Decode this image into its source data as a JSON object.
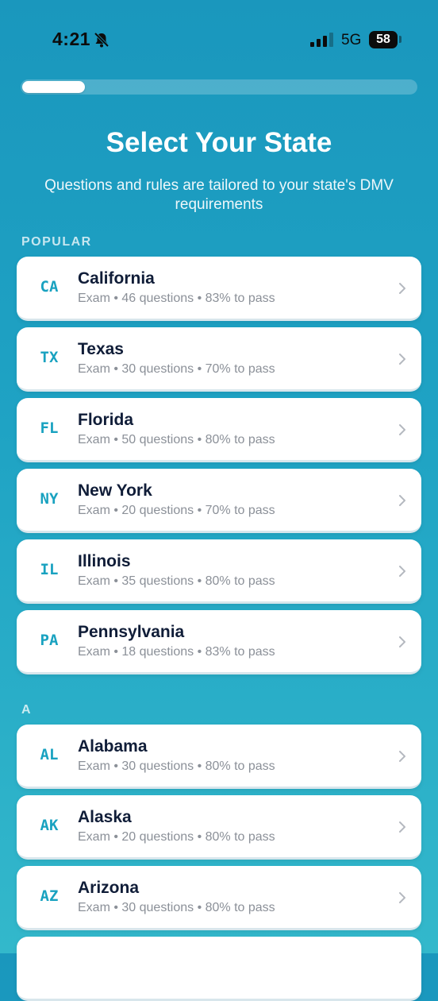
{
  "status_bar": {
    "time": "4:21",
    "network": "5G",
    "battery_level": "58"
  },
  "progress": {
    "fraction": 0.16
  },
  "title": "Select Your State",
  "subtitle": "Questions and rules are tailored to your state's DMV requirements",
  "popular_section": {
    "header": "POPULAR",
    "states": [
      {
        "code": "CA",
        "name": "California",
        "details": "Exam • 46 questions • 83% to pass"
      },
      {
        "code": "TX",
        "name": "Texas",
        "details": "Exam • 30 questions • 70% to pass"
      },
      {
        "code": "FL",
        "name": "Florida",
        "details": "Exam • 50 questions • 80% to pass"
      },
      {
        "code": "NY",
        "name": "New York",
        "details": "Exam • 20 questions • 70% to pass"
      },
      {
        "code": "IL",
        "name": "Illinois",
        "details": "Exam • 35 questions • 80% to pass"
      },
      {
        "code": "PA",
        "name": "Pennsylvania",
        "details": "Exam • 18 questions • 83% to pass"
      }
    ]
  },
  "a_section": {
    "header": "A",
    "states": [
      {
        "code": "AL",
        "name": "Alabama",
        "details": "Exam • 30 questions • 80% to pass"
      },
      {
        "code": "AK",
        "name": "Alaska",
        "details": "Exam • 20 questions • 80% to pass"
      },
      {
        "code": "AZ",
        "name": "Arizona",
        "details": "Exam • 30 questions • 80% to pass"
      }
    ]
  },
  "colors": {
    "accent": "#19a2c0",
    "background_top": "#1a97bd",
    "background_bottom": "#33b8cb"
  },
  "icons": {
    "bell": "bell-slash-icon",
    "signal": "cellular-signal-icon",
    "chevron": "chevron-right-icon"
  }
}
